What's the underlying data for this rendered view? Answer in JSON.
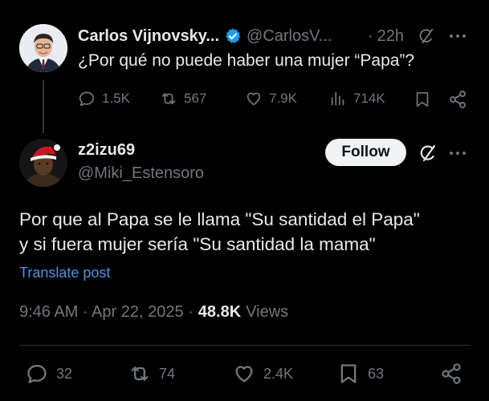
{
  "parent_post": {
    "display_name": "Carlos Vijnovsky...",
    "handle": "@CarlosV...",
    "separator": "·",
    "time_ago": "22h",
    "text": "¿Por qué no puede haber una mujer “Papa”?",
    "stats": {
      "replies": "1.5K",
      "reposts": "567",
      "likes": "7.9K",
      "views": "714K"
    }
  },
  "reply_post": {
    "display_name": "z2izu69",
    "handle": "@Miki_Estensoro",
    "follow_label": "Follow",
    "text_line1": "Por que al Papa se le llama \"Su santidad el Papa\"",
    "text_line2": "y si fuera mujer sería \"Su santidad la mama\"",
    "translate_label": "Translate post",
    "timestamp": "9:46 AM · Apr 22, 2025 ·",
    "views_count": "48.8K",
    "views_label": "Views",
    "stats": {
      "replies": "32",
      "reposts": "74",
      "likes": "2.4K",
      "bookmarks": "63"
    }
  },
  "colors": {
    "background": "#000000",
    "text": "#e7e9ea",
    "muted": "#71767b",
    "link": "#1d9bf0",
    "verified": "#1d9bf0"
  },
  "icons": [
    "verified-badge-icon",
    "grok-icon",
    "more-icon",
    "reply-icon",
    "repost-icon",
    "like-icon",
    "views-icon",
    "bookmark-icon",
    "share-icon"
  ]
}
